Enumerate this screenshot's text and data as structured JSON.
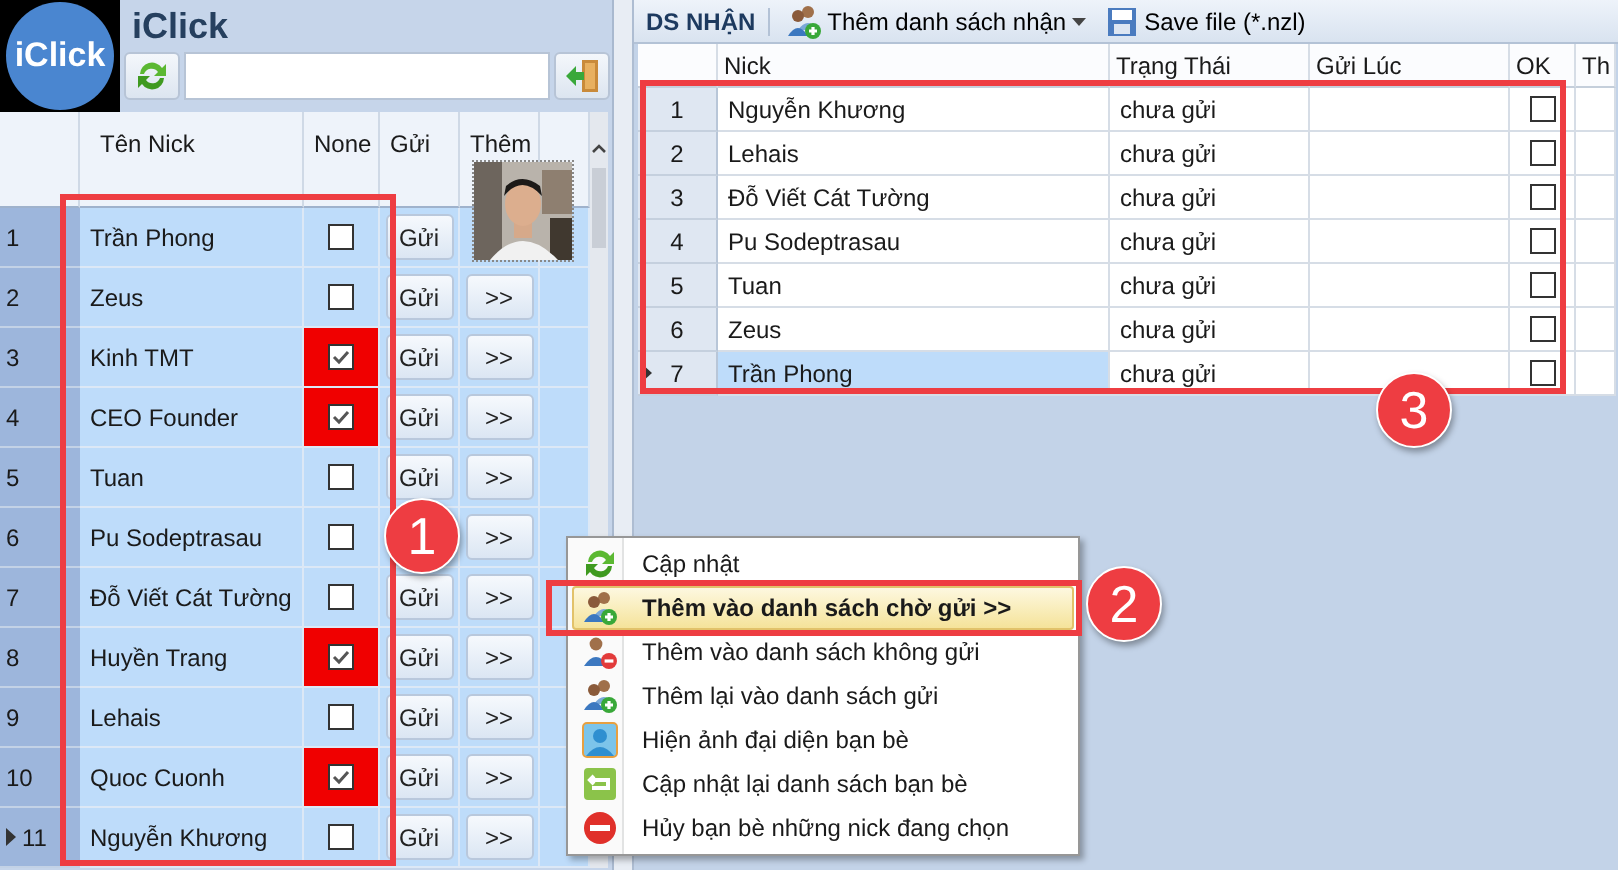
{
  "app": {
    "logo_text": "iClick",
    "title": "iClick"
  },
  "friends": {
    "columns": [
      "Tên Nick",
      "None",
      "Gửi",
      "Thêm"
    ],
    "rows": [
      {
        "number": "1",
        "name": "Trần Phong",
        "none": false,
        "send": "Gửi",
        "selected": false
      },
      {
        "number": "2",
        "name": "Zeus",
        "none": false,
        "send": "Gửi",
        "more": ">>",
        "selected": false
      },
      {
        "number": "3",
        "name": "Kinh TMT",
        "none": true,
        "send": "Gửi",
        "more": ">>",
        "selected": false
      },
      {
        "number": "4",
        "name": "CEO  Founder",
        "none": true,
        "send": "Gửi",
        "more": ">>",
        "selected": false
      },
      {
        "number": "5",
        "name": "Tuan",
        "none": false,
        "send": "Gửi",
        "more": ">>",
        "selected": false
      },
      {
        "number": "6",
        "name": "Pu Sodeptrasau",
        "none": false,
        "more": ">>",
        "selected": false
      },
      {
        "number": "7",
        "name": "Đỗ Viết Cát Tường",
        "none": false,
        "send": "Gửi",
        "more": ">>",
        "selected": false
      },
      {
        "number": "8",
        "name": "Huyền Trang",
        "none": true,
        "send": "Gửi",
        "more": ">>",
        "selected": false
      },
      {
        "number": "9",
        "name": "Lehais",
        "none": false,
        "send": "Gửi",
        "more": ">>",
        "selected": false
      },
      {
        "number": "10",
        "name": "Quoc Cuonh",
        "none": true,
        "send": "Gửi",
        "more": ">>",
        "selected": false
      },
      {
        "number": "11",
        "name": "Nguyễn Khương",
        "none": false,
        "send": "Gửi",
        "more": ">>",
        "selected": true
      }
    ]
  },
  "receive": {
    "title": "DS NHẬN",
    "toolbar": [
      {
        "kind": "add-list",
        "label": "Thêm danh sách nhận",
        "dropdown": true
      },
      {
        "kind": "save",
        "label": "Save file (*.nzl)",
        "dropdown": false
      }
    ],
    "columns": [
      "Nick",
      "Trạng Thái",
      "Gửi Lúc",
      "OK",
      "Th"
    ],
    "rows": [
      {
        "number": "1",
        "nick": "Nguyễn Khương",
        "status": "chưa gửi",
        "ok": false,
        "selected": false
      },
      {
        "number": "2",
        "nick": "Lehais",
        "status": "chưa gửi",
        "ok": false,
        "selected": false
      },
      {
        "number": "3",
        "nick": "Đỗ Viết Cát Tường",
        "status": "chưa gửi",
        "ok": false,
        "selected": false
      },
      {
        "number": "4",
        "nick": "Pu Sodeptrasau",
        "status": "chưa gửi",
        "ok": false,
        "selected": false
      },
      {
        "number": "5",
        "nick": "Tuan",
        "status": "chưa gửi",
        "ok": false,
        "selected": false
      },
      {
        "number": "6",
        "nick": "Zeus",
        "status": "chưa gửi",
        "ok": false,
        "selected": false
      },
      {
        "number": "7",
        "nick": "Trần Phong",
        "status": "chưa gửi",
        "ok": false,
        "selected": true
      }
    ]
  },
  "context_menu": {
    "items": [
      {
        "kind": "refresh",
        "label": "Cập nhật",
        "selected": false
      },
      {
        "kind": "add-user",
        "label": "Thêm vào danh sách chờ gửi >>",
        "selected": true
      },
      {
        "kind": "remove-user",
        "label": "Thêm vào danh sách không gửi",
        "selected": false
      },
      {
        "kind": "add-user",
        "label": "Thêm lại vào danh sách gửi",
        "selected": false
      },
      {
        "kind": "person",
        "label": "Hiện ảnh đại diện bạn bè",
        "selected": false
      },
      {
        "kind": "reload",
        "label": "Cập nhật lại danh sách bạn bè",
        "selected": false
      },
      {
        "kind": "cancel",
        "label": "Hủy bạn bè những nick đang chọn",
        "selected": false
      }
    ]
  },
  "annotations": [
    {
      "label": "1"
    },
    {
      "label": "2"
    },
    {
      "label": "3"
    }
  ]
}
